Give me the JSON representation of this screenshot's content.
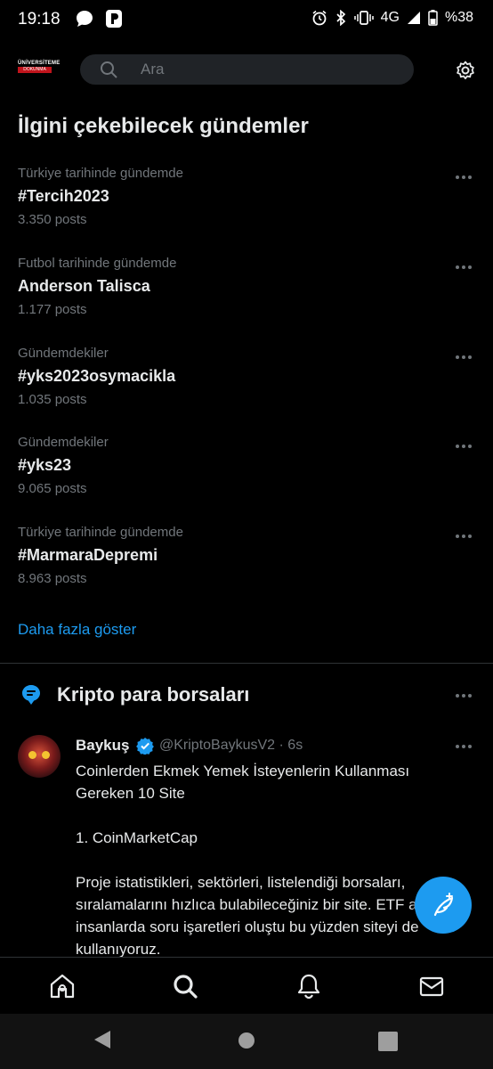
{
  "status_bar": {
    "time": "19:18",
    "network": "4G",
    "battery": "%38",
    "icons": [
      "chat-bubble-icon",
      "p-app-icon",
      "alarm-icon",
      "bluetooth-icon",
      "vibrate-icon",
      "signal-icon",
      "battery-icon"
    ]
  },
  "header": {
    "logo_line1": "ÜNİVERSİTEME",
    "logo_line2": "DOKUNMA",
    "search_placeholder": "Ara",
    "settings_icon": "gear-icon"
  },
  "trends_section": {
    "title": "İlgini çekebilecek gündemler",
    "items": [
      {
        "context": "Türkiye tarihinde gündemde",
        "name": "#Tercih2023",
        "count": "3.350 posts"
      },
      {
        "context": "Futbol tarihinde gündemde",
        "name": "Anderson Talisca",
        "count": "1.177 posts"
      },
      {
        "context": "Gündemdekiler",
        "name": "#yks2023osymacikla",
        "count": "1.035 posts"
      },
      {
        "context": "Gündemdekiler",
        "name": "#yks23",
        "count": "9.065 posts"
      },
      {
        "context": "Türkiye tarihinde gündemde",
        "name": "#MarmaraDepremi",
        "count": "8.963 posts"
      }
    ],
    "show_more": "Daha fazla göster"
  },
  "topic_section": {
    "title": "Kripto para borsaları",
    "tweet": {
      "author": "Baykuş",
      "handle_time": "@KriptoBaykusV2 · 6s",
      "lines": [
        "Coinlerden Ekmek Yemek İsteyenlerin Kullanması Gereken 10 Site",
        "1. CoinMarketCap",
        "Proje istatistikleri, sektörleri, listelendiği borsaları, sıralamalarını hızlıca bulabileceğiniz bir site. ETF alınca insanlarda soru işaretleri oluştu bu yüzden siteyi de kullanıyoruz."
      ]
    }
  },
  "colors": {
    "accent": "#1d9bf0",
    "background": "#000000",
    "muted_text": "#71767b",
    "divider": "#2f3336"
  },
  "bottom_tabs": [
    "home-icon",
    "search-icon",
    "notifications-bell-icon",
    "messages-envelope-icon"
  ],
  "system_nav": [
    "back-icon",
    "home-circle-icon",
    "recents-square-icon"
  ]
}
